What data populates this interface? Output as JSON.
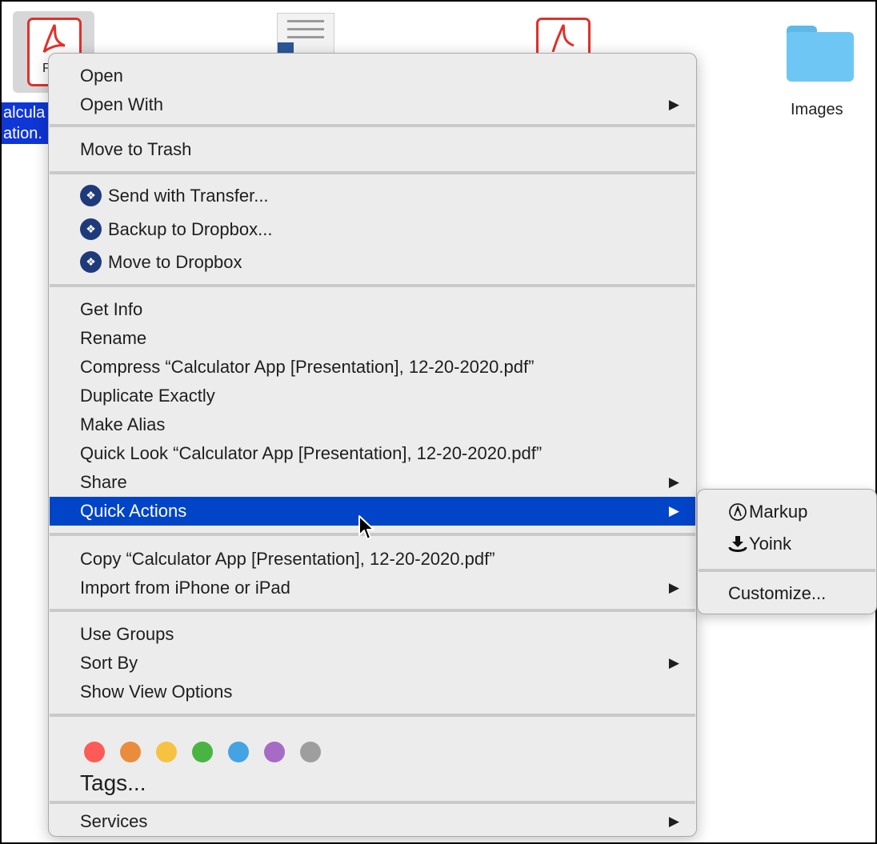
{
  "desktop": {
    "selected_file_label_line1": "alcula",
    "selected_file_label_line2": "ation.",
    "pdf_icon_letter": "P",
    "folder_label": "Images"
  },
  "menu": {
    "open": "Open",
    "open_with": "Open With",
    "move_to_trash": "Move to Trash",
    "send_with_transfer": "Send with Transfer...",
    "backup_to_dropbox": "Backup to Dropbox...",
    "move_to_dropbox": "Move to Dropbox",
    "get_info": "Get Info",
    "rename": "Rename",
    "compress": "Compress “Calculator App [Presentation], 12-20-2020.pdf”",
    "duplicate_exactly": "Duplicate Exactly",
    "make_alias": "Make Alias",
    "quick_look": "Quick Look “Calculator App [Presentation], 12-20-2020.pdf”",
    "share": "Share",
    "quick_actions": "Quick Actions",
    "copy": "Copy “Calculator App [Presentation], 12-20-2020.pdf”",
    "import_from_iphone": "Import from iPhone or iPad",
    "use_groups": "Use Groups",
    "sort_by": "Sort By",
    "show_view_options": "Show View Options",
    "tags": "Tags...",
    "services": "Services",
    "submenu_arrow": "▶"
  },
  "tag_colors": [
    "#fc5b57",
    "#e98d3c",
    "#f7c242",
    "#4ab442",
    "#44a3e3",
    "#a66bc5",
    "#9e9e9e"
  ],
  "submenu": {
    "markup": "Markup",
    "yoink": "Yoink",
    "customize": "Customize..."
  },
  "colors": {
    "highlight": "#0044c8",
    "menu_bg": "#ececec",
    "dropbox_badge": "#1f3a7a"
  }
}
